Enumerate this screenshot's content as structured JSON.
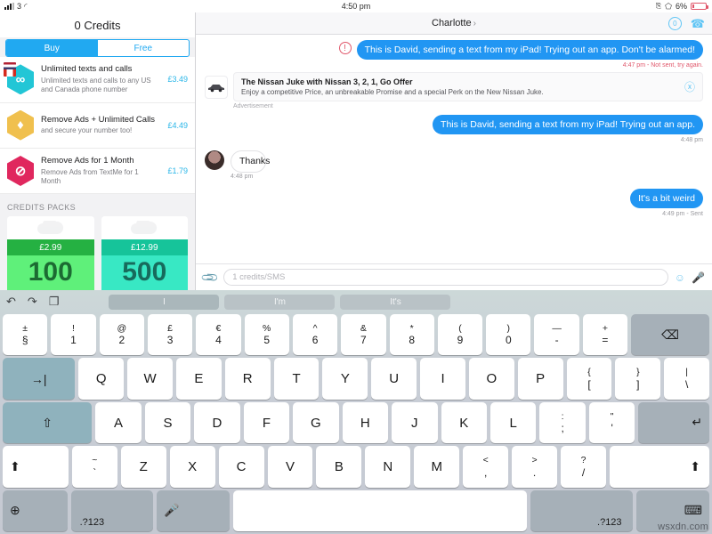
{
  "statusbar": {
    "carrier": "3",
    "wifi_icon": "wifi-icon",
    "rotation_lock_icon": "rotation-lock-icon",
    "bluetooth_icon": "bluetooth-icon",
    "battery_percent": "6%",
    "time": "4:50 pm"
  },
  "sidebar": {
    "credits_title": "0 Credits",
    "segments": [
      {
        "label": "Buy",
        "active": true
      },
      {
        "label": "Free",
        "active": false
      }
    ],
    "store_items": [
      {
        "title": "Unlimited texts and calls",
        "subtitle": "Unlimited texts and calls to any US and Canada phone number",
        "price": "£3.49",
        "icon": "infinity-hex-icon"
      },
      {
        "title": "Remove Ads + Unlimited Calls",
        "subtitle": "and secure your number too!",
        "price": "£4.49",
        "icon": "diamond-hex-icon"
      },
      {
        "title": "Remove Ads for 1 Month",
        "subtitle": "Remove Ads from TextMe for 1 Month",
        "price": "£1.79",
        "icon": "no-ads-hex-icon"
      }
    ],
    "packs_header": "CREDITS PACKS",
    "packs": [
      {
        "price": "£2.99",
        "amount": "100",
        "style": "green"
      },
      {
        "price": "£12.99",
        "amount": "500",
        "style": "mint"
      }
    ]
  },
  "chat": {
    "title": "Charlotte",
    "chevron": "›",
    "credit_badge": "0",
    "phone_icon": "phone-icon",
    "messages": [
      {
        "kind": "outgoing-error",
        "text": "This is David, sending a text from my iPad! Trying out an app. Don't be alarmed!",
        "meta": "4:47 pm - Not sent, try again."
      },
      {
        "kind": "ad",
        "title": "The Nissan Juke with Nissan 3, 2, 1, Go Offer",
        "subtitle": "Enjoy a competitive Price, an unbreakable Promise and a special Perk on the New Nissan Juke.",
        "label": "Advertisement"
      },
      {
        "kind": "outgoing",
        "text": "This is David, sending a text from my iPad! Trying out an app.",
        "meta": "4:48 pm"
      },
      {
        "kind": "incoming",
        "text": "Thanks",
        "meta": "4:48 pm"
      },
      {
        "kind": "outgoing",
        "text": "It's a bit weird",
        "meta": "4:49 pm - Sent"
      }
    ]
  },
  "composer": {
    "attach_icon": "paperclip-icon",
    "placeholder": "1 credits/SMS",
    "value": "",
    "emoji_icon": "smiley-icon",
    "mic_icon": "microphone-icon"
  },
  "keyboard": {
    "tools": [
      {
        "icon": "undo-icon",
        "glyph": "↶"
      },
      {
        "icon": "redo-icon",
        "glyph": "↷"
      },
      {
        "icon": "paste-icon",
        "glyph": "❐"
      }
    ],
    "suggestions": [
      "I",
      "I'm",
      "It's"
    ],
    "number_row": [
      {
        "up": "±",
        "lo": "§"
      },
      {
        "up": "!",
        "lo": "1"
      },
      {
        "up": "@",
        "lo": "2"
      },
      {
        "up": "£",
        "lo": "3"
      },
      {
        "up": "€",
        "lo": "4"
      },
      {
        "up": "%",
        "lo": "5"
      },
      {
        "up": "^",
        "lo": "6"
      },
      {
        "up": "&",
        "lo": "7"
      },
      {
        "up": "*",
        "lo": "8"
      },
      {
        "up": "(",
        "lo": "9"
      },
      {
        "up": ")",
        "lo": "0"
      },
      {
        "up": "—",
        "lo": "-"
      },
      {
        "up": "+",
        "lo": "="
      }
    ],
    "backspace_glyph": "⌫",
    "tab_glyph": "→|",
    "row_q": [
      "Q",
      "W",
      "E",
      "R",
      "T",
      "Y",
      "U",
      "I",
      "O",
      "P"
    ],
    "row_q_extra": [
      {
        "up": "{",
        "lo": "["
      },
      {
        "up": "}",
        "lo": "]"
      },
      {
        "up": "|",
        "lo": "\\"
      }
    ],
    "caps_glyph": "⇧",
    "row_a": [
      "A",
      "S",
      "D",
      "F",
      "G",
      "H",
      "J",
      "K",
      "L"
    ],
    "row_a_extra": [
      {
        "up": ":",
        "lo": ";"
      },
      {
        "up": "\"",
        "lo": "'"
      }
    ],
    "enter_glyph": "↵",
    "shift_glyph": "⬆",
    "row_z_tilde": {
      "up": "~",
      "lo": "`"
    },
    "row_z": [
      "Z",
      "X",
      "C",
      "V",
      "B",
      "N",
      "M"
    ],
    "row_z_extra": [
      {
        "up": "<",
        "lo": ","
      },
      {
        "up": ">",
        "lo": "."
      },
      {
        "up": "?",
        "lo": "/"
      }
    ],
    "globe_glyph": "⊕",
    "num_label": ".?123",
    "mic_glyph": "ᵓ",
    "space_label": "",
    "hide_keyboard_glyph": "⌨",
    "watermark": "wsxdn.com"
  }
}
